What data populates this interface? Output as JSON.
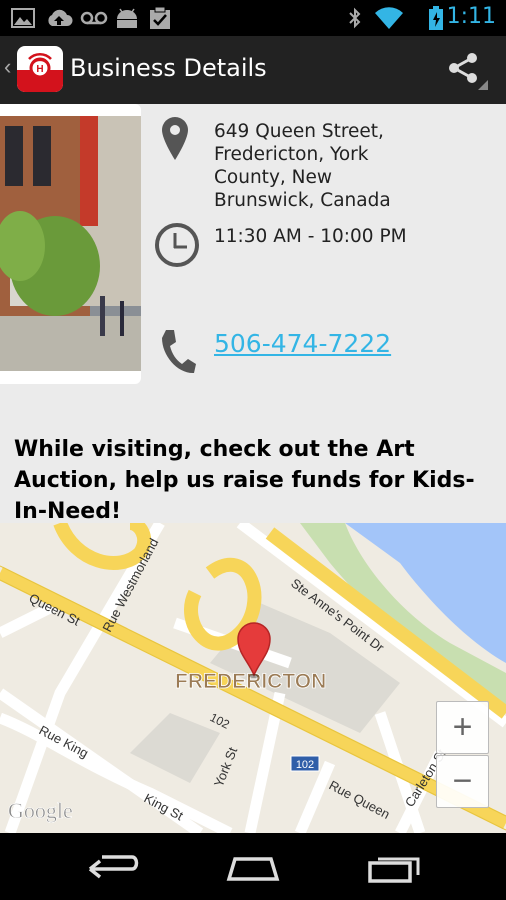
{
  "status_bar": {
    "time": "1:11",
    "left_icons": [
      "image-icon",
      "cloud-upload-icon",
      "voicemail-icon",
      "android-icon",
      "clipboard-check-icon"
    ],
    "right_icons": [
      "bluetooth-icon",
      "wifi-icon",
      "battery-charging-icon"
    ]
  },
  "action_bar": {
    "title": "Business Details",
    "logo_icon": "app-logo-icon",
    "share_icon": "share-icon"
  },
  "details": {
    "address": "649 Queen Street,\nFredericton, York\nCounty, New\nBrunswick, Canada",
    "hours": "11:30 AM - 10:00 PM",
    "phone": "506-474-7222"
  },
  "promo_text": "While visiting, check out the Art Auction, help us raise funds for Kids-In-Need!",
  "map": {
    "city_label": "FREDERICTON",
    "streets": [
      "Queen St",
      "Rue Westmorland",
      "Ste Anne's Point Dr",
      "Rue King",
      "King St",
      "York St",
      "Rue Queen",
      "Carleton St"
    ],
    "route_shield_1": "102",
    "route_shield_2": "102",
    "attribution": "Google",
    "zoom_in_label": "+",
    "zoom_out_label": "−",
    "colors": {
      "road": "#ffffff",
      "highway": "#f7d559",
      "land": "#efebe2",
      "water": "#a3c5f9",
      "park": "#c8dfb0",
      "pin": "#e53b3b"
    }
  },
  "colors": {
    "accent": "#33b5e5",
    "action_bar": "#222222",
    "content_bg": "#ebebeb"
  }
}
